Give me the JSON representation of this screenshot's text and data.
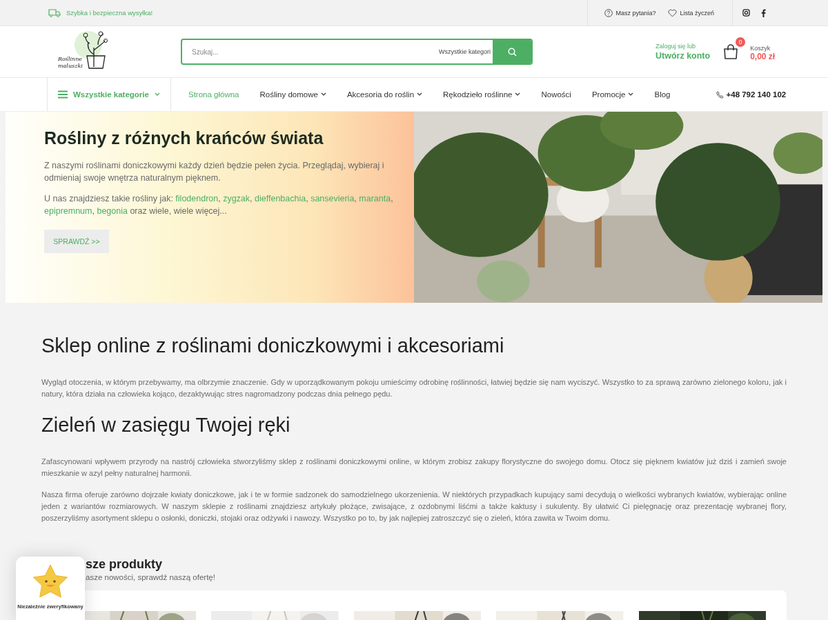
{
  "top_bar": {
    "shipping": "Szybka i bezpieczna wysyłka!",
    "links": [
      {
        "kind": "help",
        "label": "Masz pytania?"
      },
      {
        "kind": "wishlist",
        "label": "Lista życzeń"
      }
    ],
    "social": [
      {
        "kind": "instagram"
      },
      {
        "kind": "facebook"
      }
    ]
  },
  "header": {
    "logo": [
      "Roślinne",
      "maluszki"
    ],
    "search": {
      "placeholder": "Szukaj...",
      "category": "Wszystkie kategori"
    },
    "account": {
      "line1": "Zaloguj się lub",
      "line2": "Utwórz konto"
    },
    "cart": {
      "count": "0",
      "label": "Koszyk",
      "total": "0,00 zł"
    }
  },
  "nav": {
    "categories": "Wszystkie kategorie",
    "items": [
      {
        "label": "Strona główna",
        "selected": true,
        "dropdown": false
      },
      {
        "label": "Rośliny domowe",
        "selected": false,
        "dropdown": true
      },
      {
        "label": "Akcesoria do roślin",
        "selected": false,
        "dropdown": true
      },
      {
        "label": "Rękodzieło roślinne",
        "selected": false,
        "dropdown": true
      },
      {
        "label": "Nowości",
        "selected": false,
        "dropdown": false
      },
      {
        "label": "Promocje",
        "selected": false,
        "dropdown": true
      },
      {
        "label": "Blog",
        "selected": false,
        "dropdown": false
      }
    ],
    "phone": "+48 792 140 102"
  },
  "hero": {
    "title": "Rośliny z różnych krańców świata",
    "text": "Z naszymi roślinami doniczkowymi każdy dzień będzie pełen życia. Przeglądaj, wybieraj i odmieniaj swoje wnętrza naturalnym pięknem.",
    "list_intro": "U nas znajdziesz takie rośliny jak:",
    "separator": ", ",
    "plants": [
      "filodendron",
      "zygzak",
      "dieffenbachia",
      "sansevieria",
      "maranta",
      "epipremnum",
      "begonia"
    ],
    "list_outro": "oraz wiele, wiele więcej...",
    "button": "SPRAWDŹ >>"
  },
  "sections": [
    {
      "heading": "Sklep online z roślinami doniczkowymi i akcesoriami",
      "paragraphs": [
        "Wygląd otoczenia, w którym przebywamy, ma olbrzymie znaczenie. Gdy w uporządkowanym pokoju umieścimy odrobinę roślinności, łatwiej będzie się nam wyciszyć. Wszystko to za sprawą zarówno zielonego koloru, jak i natury, która działa na człowieka kojąco, dezaktywując stres nagromadzony podczas dnia pełnego pędu."
      ]
    },
    {
      "heading": "Zieleń w zasięgu Twojej ręki",
      "paragraphs": [
        "Zafascynowani wpływem przyrody na nastrój człowieka stworzyliśmy sklep z roślinami doniczkowymi online, w którym zrobisz zakupy florystyczne do swojego domu. Otocz się pięknem kwiatów już dziś i zamień swoje mieszkanie w azyl pełny naturalnej harmonii.",
        "Nasza firma oferuje zarówno dojrzałe kwiaty doniczkowe, jak i te w formie sadzonek do samodzielnego ukorzenienia. W niektórych przypadkach kupujący sami decydują o wielkości wybranych kwiatów, wybierając online jeden z wariantów rozmiarowych. W naszym sklepie z roślinami znajdziesz artykuły płożące, zwisające, z ozdobnymi liśćmi a także kaktusy i sukulenty. By ułatwić Ci pielęgnację oraz prezentację wybranej flory, poszerzyliśmy asortyment sklepu o osłonki, doniczki, stojaki oraz odżywki i nawozy. Wszystko po to, by jak najlepiej zatroszczyć się o zieleń, która zawita w Twoim domu."
      ]
    }
  ],
  "products": {
    "heading": "sze produkty",
    "subtitle": "asze nowości, sprawdź naszą ofertę!"
  },
  "badge": {
    "label": "Niezależnie zweryfikowany"
  }
}
